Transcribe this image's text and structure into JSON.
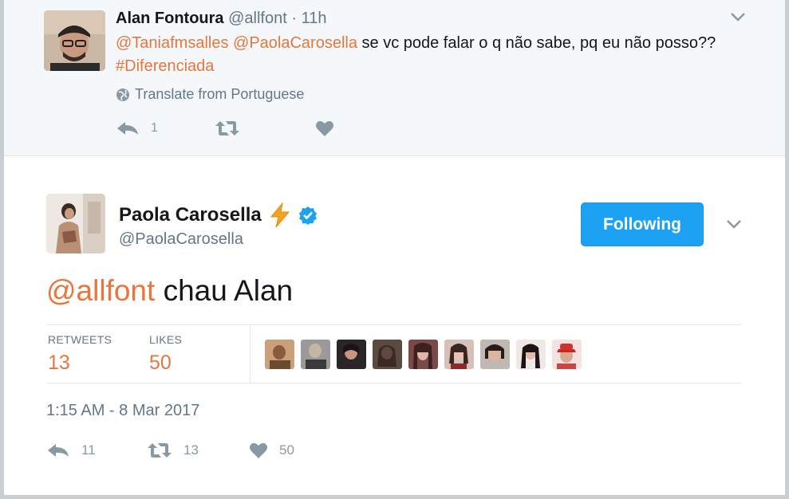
{
  "parent_tweet": {
    "name": "Alan Fontoura",
    "handle": "@allfont",
    "separator": "·",
    "time": "11h",
    "mention1": "@Taniafmsalles",
    "mention2": "@PaolaCarosella",
    "text": " se vc pode falar o q não sabe, pq eu não posso?? ",
    "hashtag": "#Diferenciada",
    "translate_label": "Translate from Portuguese",
    "reply_count": "1"
  },
  "main_tweet": {
    "name": "Paola Carosella",
    "emoji": "⚡",
    "handle": "@PaolaCarosella",
    "follow_label": "Following",
    "mention": "@allfont",
    "text": " chau Alan",
    "retweets_label": "RETWEETS",
    "retweets_value": "13",
    "likes_label": "LIKES",
    "likes_value": "50",
    "timestamp": "1:15 AM - 8 Mar 2017",
    "reply_count": "11",
    "retweet_count": "13",
    "like_count": "50"
  },
  "colors": {
    "accent": "#e8763c",
    "follow_button": "#1da1f2",
    "muted": "#657786",
    "verified": "#1da1f2",
    "parent_background": "#f5f8fa"
  },
  "icons": [
    "globe-icon",
    "reply-icon",
    "retweet-icon",
    "heart-icon",
    "chevron-down-icon",
    "verified-badge-icon",
    "lightning-emoji"
  ]
}
